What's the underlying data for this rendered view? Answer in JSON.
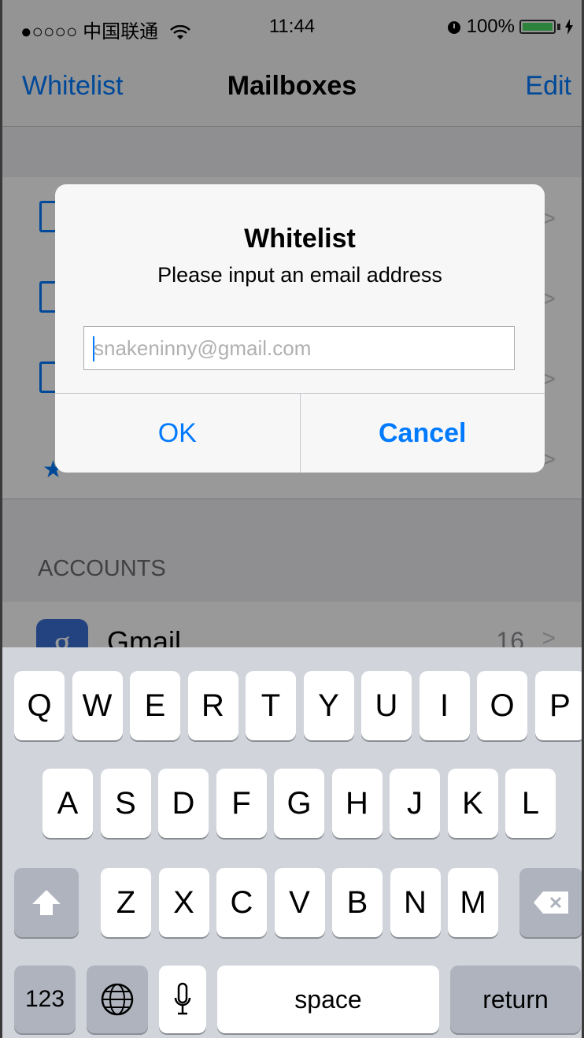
{
  "status_bar": {
    "carrier": "●○○○○ 中国联通",
    "time": "11:44",
    "battery": "100%"
  },
  "nav": {
    "back_label": "Whitelist",
    "title": "Mailboxes",
    "edit_label": "Edit"
  },
  "accounts": {
    "section_label": "ACCOUNTS",
    "gmail": {
      "name": "Gmail",
      "count": "16"
    }
  },
  "alert": {
    "title": "Whitelist",
    "message": "Please input an email address",
    "input_placeholder": "snakeninny@gmail.com",
    "ok_label": "OK",
    "cancel_label": "Cancel"
  },
  "keyboard": {
    "row1": [
      "Q",
      "W",
      "E",
      "R",
      "T",
      "Y",
      "U",
      "I",
      "O",
      "P"
    ],
    "row2": [
      "A",
      "S",
      "D",
      "F",
      "G",
      "H",
      "J",
      "K",
      "L"
    ],
    "row3": [
      "Z",
      "X",
      "C",
      "V",
      "B",
      "N",
      "M"
    ],
    "numbers_label": "123",
    "space_label": "space",
    "return_label": "return"
  },
  "colors": {
    "accent": "#007aff",
    "keyboard_bg": "#d1d5db",
    "battery_fill": "#4cd964"
  }
}
